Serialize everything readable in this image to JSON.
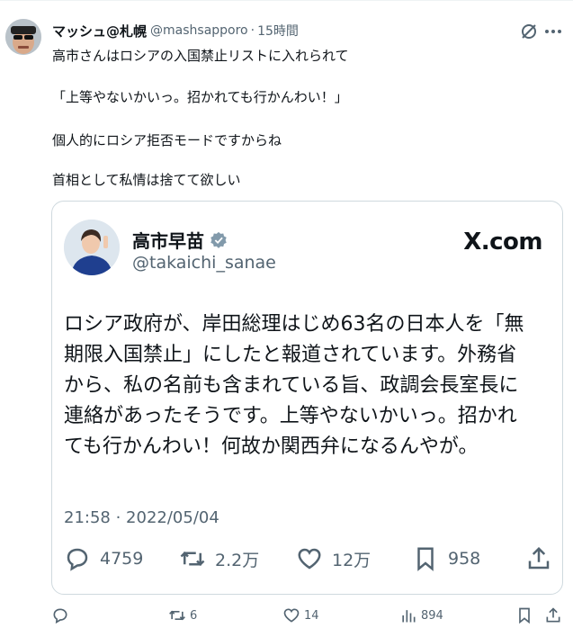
{
  "post": {
    "display_name": "マッシュ@札幌",
    "handle": "@mashsapporo",
    "separator": "·",
    "time": "15時間",
    "lines": [
      "高市さんはロシアの入国禁止リストに入れられて",
      "「上等やないかいっ。招かれても行かんわい！」",
      "個人的にロシア拒否モードですからね",
      "首相として私情は捨てて欲しい"
    ]
  },
  "quote": {
    "display_name": "高市早苗",
    "handle": "@takaichi_sanae",
    "brand": "X.com",
    "text_lines": [
      "ロシア政府が、岸田総理はじめ63名の日本人を「無",
      "期限入国禁止」にしたと報道されています。外務省",
      "から、私の名前も含まれている旨、政調会長室長に",
      "連絡があったそうです。上等やないかいっ。招かれ",
      "ても行かんわい！何故か関西弁になるんやが。"
    ],
    "date": "21:58 · 2022/05/04",
    "stats": {
      "replies": "4759",
      "retweets": "2.2万",
      "likes": "12万",
      "bookmarks": "958"
    }
  },
  "actions": {
    "replies": "",
    "reposts": "6",
    "likes": "14",
    "views": "894"
  },
  "colors": {
    "text": "#0f1419",
    "muted": "#536471",
    "border": "#cfd9de",
    "verified": "#829aab"
  }
}
